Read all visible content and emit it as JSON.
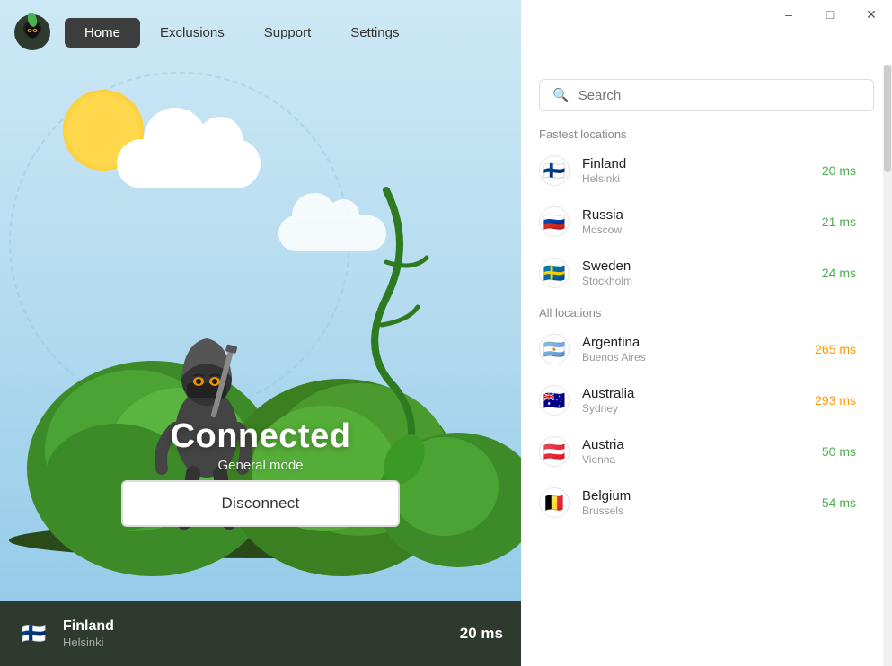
{
  "titlebar": {
    "minimize_label": "–",
    "maximize_label": "□",
    "close_label": "✕"
  },
  "navbar": {
    "tabs": [
      {
        "id": "home",
        "label": "Home",
        "active": true
      },
      {
        "id": "exclusions",
        "label": "Exclusions",
        "active": false
      },
      {
        "id": "support",
        "label": "Support",
        "active": false
      },
      {
        "id": "settings",
        "label": "Settings",
        "active": false
      }
    ]
  },
  "left_panel": {
    "status": "Connected",
    "mode": "General mode",
    "disconnect_label": "Disconnect"
  },
  "status_bar": {
    "country": "Finland",
    "city": "Helsinki",
    "ping": "20 ms",
    "flag": "🇫🇮"
  },
  "right_panel": {
    "search_placeholder": "Search",
    "fastest_label": "Fastest locations",
    "all_label": "All locations",
    "fastest_locations": [
      {
        "country": "Finland",
        "city": "Helsinki",
        "ping": "20 ms",
        "ping_class": "ping-green",
        "flag": "🇫🇮"
      },
      {
        "country": "Russia",
        "city": "Moscow",
        "ping": "21 ms",
        "ping_class": "ping-green",
        "flag": "🇷🇺"
      },
      {
        "country": "Sweden",
        "city": "Stockholm",
        "ping": "24 ms",
        "ping_class": "ping-green",
        "flag": "🇸🇪"
      }
    ],
    "all_locations": [
      {
        "country": "Argentina",
        "city": "Buenos Aires",
        "ping": "265 ms",
        "ping_class": "ping-orange",
        "flag": "🇦🇷"
      },
      {
        "country": "Australia",
        "city": "Sydney",
        "ping": "293 ms",
        "ping_class": "ping-orange",
        "flag": "🇦🇺"
      },
      {
        "country": "Austria",
        "city": "Vienna",
        "ping": "50 ms",
        "ping_class": "ping-green",
        "flag": "🇦🇹"
      },
      {
        "country": "Belgium",
        "city": "Brussels",
        "ping": "54 ms",
        "ping_class": "ping-green",
        "flag": "🇧🇪"
      }
    ]
  }
}
